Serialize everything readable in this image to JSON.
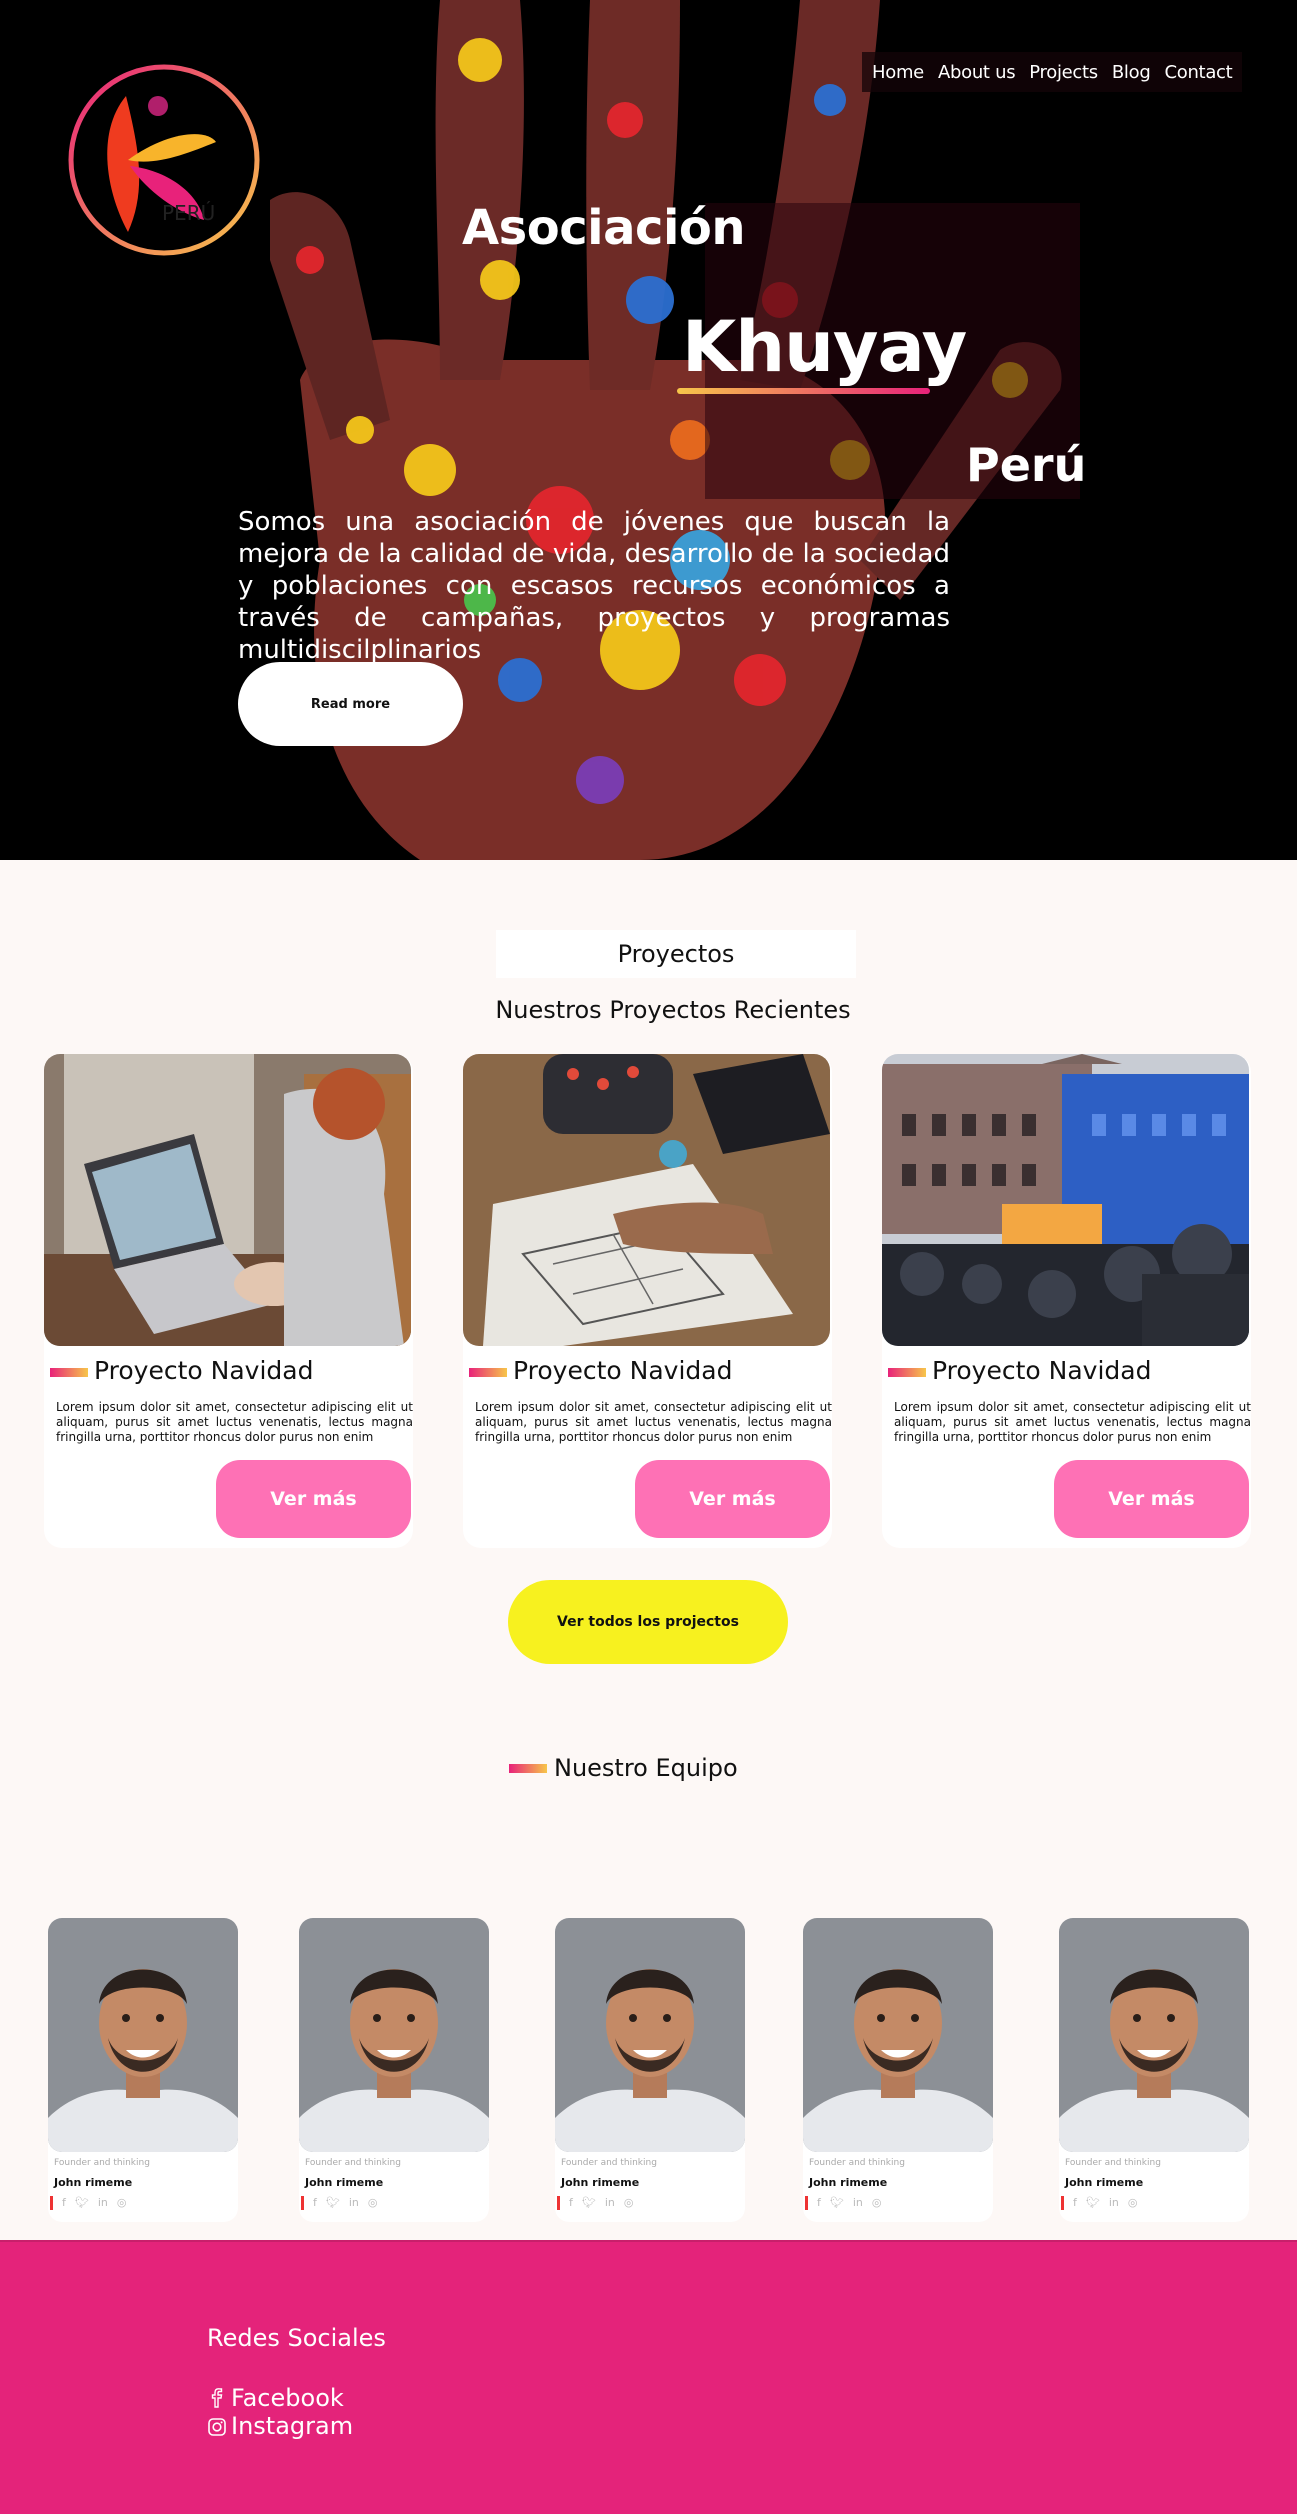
{
  "nav": {
    "items": [
      {
        "label": "Home"
      },
      {
        "label": "About us"
      },
      {
        "label": "Projects"
      },
      {
        "label": "Blog"
      },
      {
        "label": "Contact"
      }
    ]
  },
  "hero": {
    "title_line1": "Asociación",
    "title_line2": "Khuyay",
    "title_line3": "Perú",
    "description": "Somos una asociación de jóvenes que buscan la mejora de la calidad de vida, desarrollo de la sociedad y poblaciones con escasos recursos económicos a través de campañas, proyectos y programas multidiscilplinarios",
    "button_label": "Read more",
    "logo_text": "PERÚ"
  },
  "projects": {
    "label": "Proyectos",
    "subtitle": "Nuestros Proyectos Recientes",
    "cards": [
      {
        "title": "Proyecto Navidad",
        "text": "Lorem ipsum dolor sit amet, consectetur adipiscing elit ut aliquam, purus sit amet luctus venenatis, lectus magna fringilla urna, porttitor rhoncus dolor purus non enim",
        "button": "Ver más",
        "image": "laptop-photo"
      },
      {
        "title": "Proyecto Navidad",
        "text": "Lorem ipsum dolor sit amet, consectetur adipiscing elit ut aliquam, purus sit amet luctus venenatis, lectus magna fringilla urna, porttitor rhoncus dolor purus non enim",
        "button": "Ver más",
        "image": "sketch-desk-photo"
      },
      {
        "title": "Proyecto Navidad",
        "text": "Lorem ipsum dolor sit amet, consectetur adipiscing elit ut aliquam, purus sit amet luctus venenatis, lectus magna fringilla urna, porttitor rhoncus dolor purus non enim",
        "button": "Ver más",
        "image": "crowd-building-photo"
      }
    ],
    "see_all_label": "Ver todos los projectos"
  },
  "team": {
    "title": "Nuestro Equipo",
    "members": [
      {
        "role": "Founder and thinking",
        "name": "John rimeme"
      },
      {
        "role": "Founder and thinking",
        "name": "John rimeme"
      },
      {
        "role": "Founder and thinking",
        "name": "John rimeme"
      },
      {
        "role": "Founder and thinking",
        "name": "John rimeme"
      },
      {
        "role": "Founder and thinking",
        "name": "John rimeme"
      }
    ],
    "social_icons": [
      "facebook-icon",
      "twitter-icon",
      "linkedin-icon",
      "instagram-icon"
    ]
  },
  "footer": {
    "title": "Redes Sociales",
    "links": [
      {
        "label": "Facebook",
        "icon": "facebook-icon"
      },
      {
        "label": "Instagram",
        "icon": "instagram-icon"
      }
    ]
  },
  "colors": {
    "accent_pink": "#e4237a",
    "button_pink": "#fe71b5",
    "button_yellow": "#f7f11f",
    "gradient_yellow": "#f7c64a"
  }
}
